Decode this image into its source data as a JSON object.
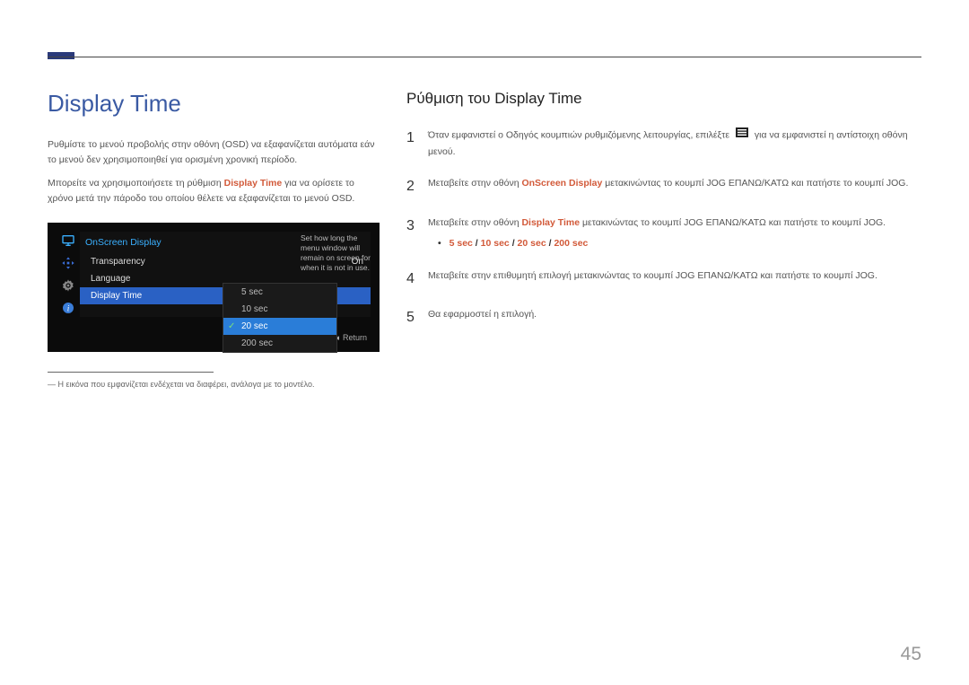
{
  "accent_rust": "#d25a3a",
  "accent_blue": "#3a5aa3",
  "page_number": "45",
  "left": {
    "title": "Display Time",
    "p1a": "Ρυθμίστε το μενού προβολής στην οθόνη (OSD) να εξαφανίζεται αυτόματα εάν το μενού δεν χρησιμοποιηθεί για ορισμένη χρονική περίοδο.",
    "p2a": "Μπορείτε να χρησιμοποιήσετε τη ρύθμιση ",
    "p2hl": "Display Time",
    "p2b": " για να ορίσετε το χρόνο μετά την πάροδο του οποίου θέλετε να εξαφανίζεται το μενού OSD."
  },
  "osd": {
    "header": "OnScreen Display",
    "items": [
      {
        "label": "Transparency",
        "value": "On",
        "selected": false
      },
      {
        "label": "Language",
        "value": "",
        "selected": false
      },
      {
        "label": "Display Time",
        "value": "",
        "selected": true
      }
    ],
    "popup": [
      {
        "label": "5 sec",
        "selected": false
      },
      {
        "label": "10 sec",
        "selected": false
      },
      {
        "label": "20 sec",
        "selected": true
      },
      {
        "label": "200 sec",
        "selected": false
      }
    ],
    "help": "Set how long the menu window will remain on screen for when it is not in use.",
    "return": "Return"
  },
  "footnote": "Η εικόνα που εμφανίζεται ενδέχεται να διαφέρει, ανάλογα με το μοντέλο.",
  "right": {
    "title": "Ρύθμιση του Display Time",
    "steps": {
      "s1a": "Όταν εμφανιστεί ο Οδηγός κουμπιών ρυθμιζόμενης λειτουργίας, επιλέξτε ",
      "s1b": " για να εμφανιστεί η αντίστοιχη οθόνη μενού.",
      "s2a": "Μεταβείτε στην οθόνη ",
      "s2hl": "OnScreen Display",
      "s2b": " μετακινώντας το κουμπί JOG ΕΠΑΝΩ/ΚΑΤΩ και πατήστε το κουμπί JOG.",
      "s3a": "Μεταβείτε στην οθόνη ",
      "s3hl": "Display Time",
      "s3b": " μετακινώντας το κουμπί JOG ΕΠΑΝΩ/ΚΑΤΩ και πατήστε το κουμπί JOG.",
      "opts": {
        "o1": "5 sec",
        "o2": "10 sec",
        "o3": "20 sec",
        "o4": "200 sec",
        "sep": " / "
      },
      "s4": "Μεταβείτε στην επιθυμητή επιλογή μετακινώντας το κουμπί JOG ΕΠΑΝΩ/ΚΑΤΩ και πατήστε το κουμπί JOG.",
      "s5": "Θα εφαρμοστεί η επιλογή."
    }
  }
}
